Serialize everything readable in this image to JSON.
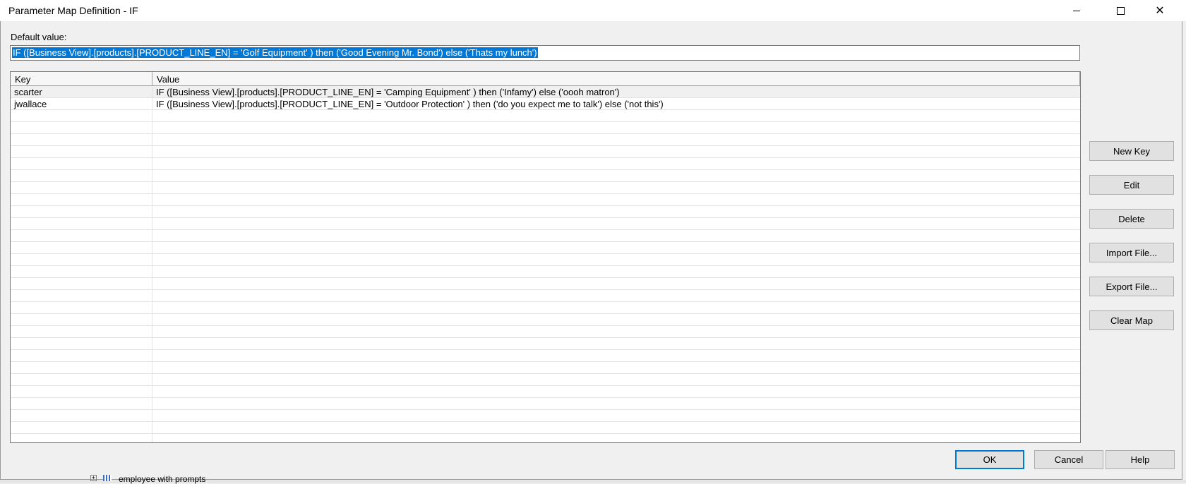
{
  "window": {
    "title": "Parameter Map Definition - IF",
    "minimize": "—",
    "maximize": "☐",
    "close": "✕"
  },
  "default_value": {
    "label": "Default value:",
    "value": "IF ([Business View].[products].[PRODUCT_LINE_EN]     = 'Golf Equipment' ) then ('Good Evening Mr. Bond') else ('Thats my lunch')"
  },
  "table": {
    "headers": {
      "key": "Key",
      "value": "Value"
    },
    "rows": [
      {
        "key": "scarter",
        "value": "IF ([Business View].[products].[PRODUCT_LINE_EN]     = 'Camping Equipment' ) then ('Infamy') else ('oooh matron')"
      },
      {
        "key": "jwallace",
        "value": "IF ([Business View].[products].[PRODUCT_LINE_EN]     = 'Outdoor Protection' ) then ('do you expect me to talk') else ('not this')"
      }
    ]
  },
  "side_buttons": {
    "new_key": "New Key",
    "edit": "Edit",
    "delete": "Delete",
    "import_file": "Import File...",
    "export_file": "Export File...",
    "clear_map": "Clear Map"
  },
  "bottom_buttons": {
    "ok": "OK",
    "cancel": "Cancel",
    "help": "Help"
  },
  "background": {
    "tree_item": "employee with prompts"
  },
  "colors": {
    "selection": "#0078d7",
    "dialog_bg": "#f0f0f0"
  }
}
